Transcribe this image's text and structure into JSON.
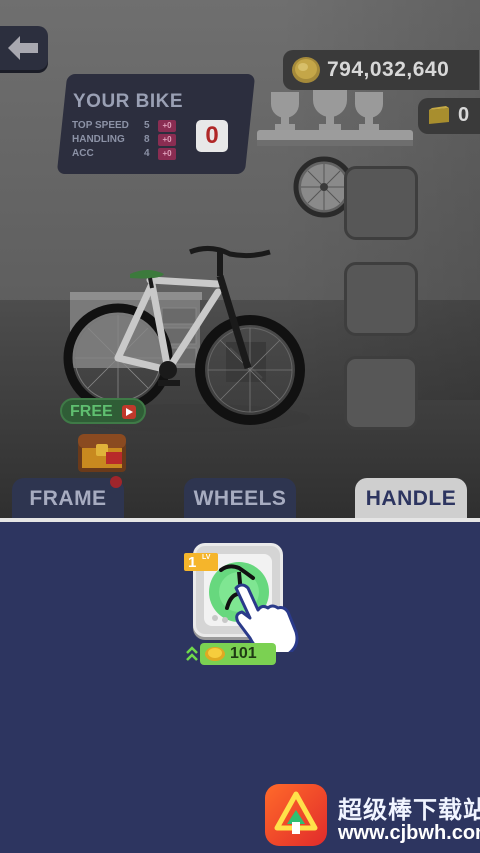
{
  "currency": {
    "coins": "794,032,640",
    "gems": "0"
  },
  "stats": {
    "title": "YOUR BIKE",
    "rows": [
      {
        "label": "TOP SPEED",
        "value": "5",
        "bonus": "+0"
      },
      {
        "label": "HANDLING",
        "value": "8",
        "bonus": "+0"
      },
      {
        "label": "ACC",
        "value": "4",
        "bonus": "+0"
      }
    ],
    "score": "0"
  },
  "promo": {
    "free_label": "FREE"
  },
  "tabs": {
    "frame": "FRAME",
    "wheels": "WHEELS",
    "handle": "HANDLE",
    "selected": "HANDLE"
  },
  "item": {
    "level": "1",
    "level_suffix": "LV",
    "price": "101"
  },
  "watermark": {
    "name": "超级棒下载站",
    "url": "www.cjbwh.com"
  },
  "colors": {
    "panel_bg": "#2d3560",
    "coin": "#f0c02a",
    "price_green": "#7bd152",
    "lv_badge": "#f5b52b",
    "score_red": "#b02727"
  }
}
